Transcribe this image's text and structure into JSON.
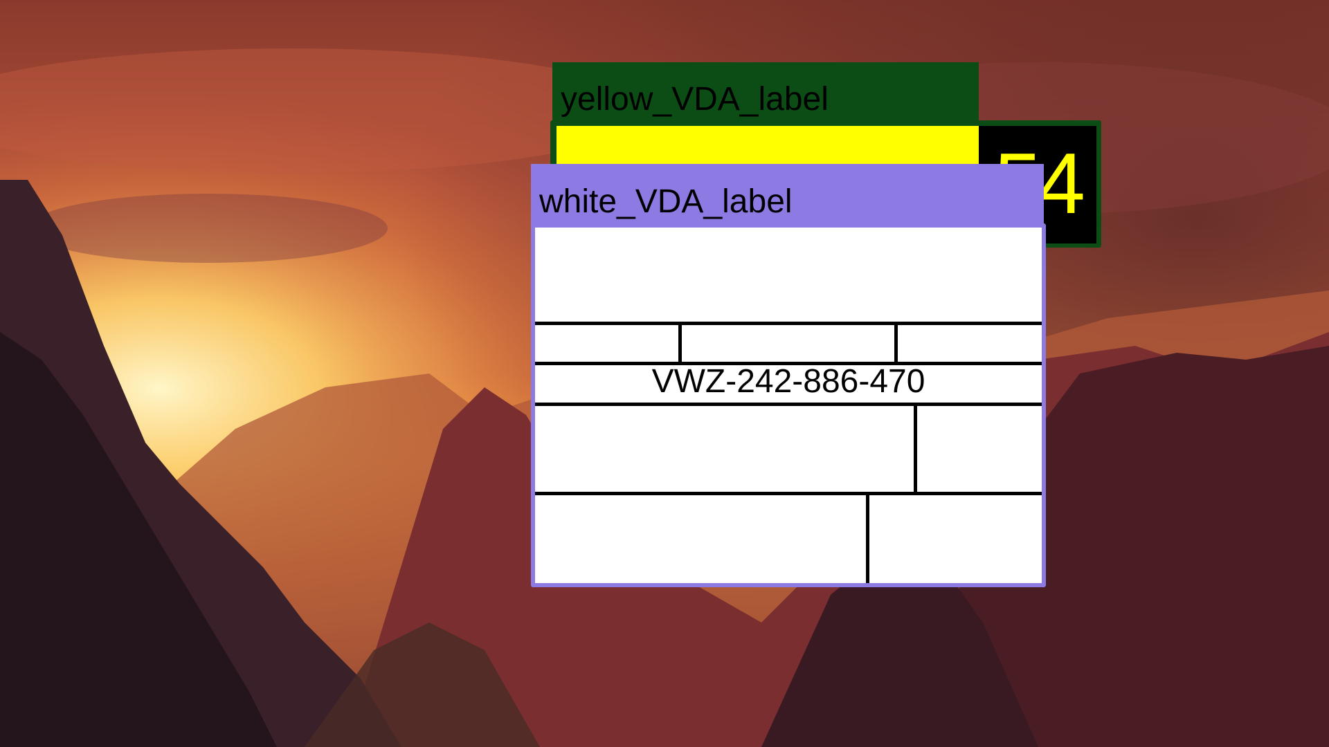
{
  "desktop": {
    "wallpaper": "sunset-mountain-valley",
    "colors": {
      "sky_top": "#7a2a22",
      "sky_glow": "#f7b25a",
      "mountain": "#2a1418"
    }
  },
  "yellow_window": {
    "title": "yellow_VDA_label",
    "count": "54",
    "colors": {
      "titlebar": "#0b4d15",
      "field": "#ffff00",
      "panel": "#000000",
      "count_text": "#ffff00"
    }
  },
  "white_window": {
    "title": "white_VDA_label",
    "serial": "VWZ-242-886-470",
    "colors": {
      "titlebar": "#8e7ae3",
      "sheet": "#ffffff",
      "rule": "#000000"
    }
  }
}
